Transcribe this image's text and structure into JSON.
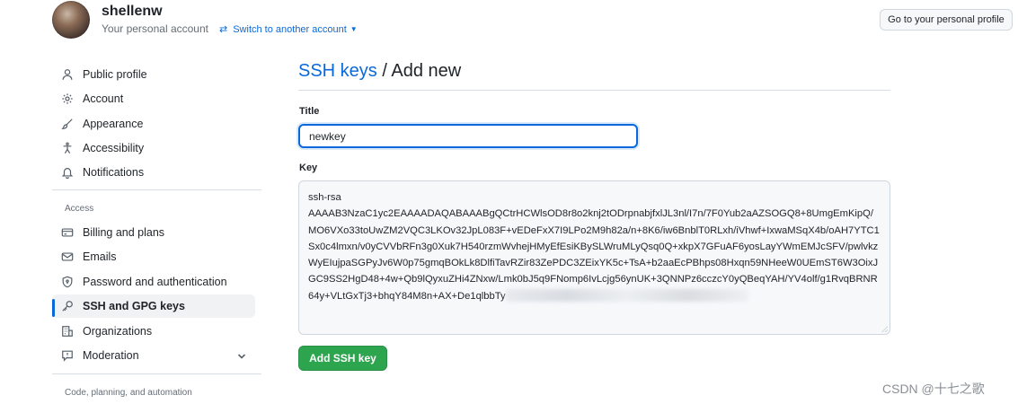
{
  "header": {
    "username": "shellenw",
    "subtitle": "Your personal account",
    "switch_label": "Switch to another account",
    "profile_button": "Go to your personal profile"
  },
  "sidebar": {
    "items": [
      {
        "label": "Public profile",
        "icon": "person-icon"
      },
      {
        "label": "Account",
        "icon": "gear-icon"
      },
      {
        "label": "Appearance",
        "icon": "paintbrush-icon"
      },
      {
        "label": "Accessibility",
        "icon": "accessibility-icon"
      },
      {
        "label": "Notifications",
        "icon": "bell-icon"
      }
    ],
    "access_heading": "Access",
    "access_items": [
      {
        "label": "Billing and plans",
        "icon": "credit-card-icon"
      },
      {
        "label": "Emails",
        "icon": "mail-icon"
      },
      {
        "label": "Password and authentication",
        "icon": "shield-lock-icon"
      },
      {
        "label": "SSH and GPG keys",
        "icon": "key-icon",
        "active": true
      },
      {
        "label": "Organizations",
        "icon": "organization-icon"
      },
      {
        "label": "Moderation",
        "icon": "report-icon"
      }
    ],
    "code_heading": "Code, planning, and automation"
  },
  "main": {
    "breadcrumb": "SSH keys",
    "separator": "/",
    "title": "Add new",
    "title_label": "Title",
    "title_value": "newkey",
    "key_label": "Key",
    "key_value": "ssh-rsa\nAAAAB3NzaC1yc2EAAAADAQABAAABgQCtrHCWlsOD8r8o2knj2tODrpnabjfxlJL3nl/I7n/7F0Yub2aAZSOGQ8+8UmgEmKipQ/MO6VXo33toUwZM2VQC3LKOv32JpL083F+vEDeFxX7I9LPo2M9h82a/n+8K6/iw6BnblT0RLxh/iVhwf+IxwaMSqX4b/oAH7YTC1Sx0c4lmxn/v0yCVVbRFn3g0Xuk7H540rzmWvhejHMyEfEsiKBySLWruMLyQsq0Q+xkpX7GFuAF6yosLayYWmEMJcSFV/pwlvkzWyEIujpaSGPyJv6W0p75gmqBOkLk8DlfiTavRZir83ZePDC3ZEixYK5c+TsA+b2aaEcPBhps08Hxqn59NHeeW0UEmST6W3OixJGC9SS2HgD48+4w+Qb9lQyxuZHi4ZNxw/Lmk0bJ5q9FNomp6IvLcjg56ynUK+3QNNPz6cczcY0yQBeqYAH/YV4olf/g1RvqBRNR64y+VLtGxTj3+bhqY84M8n+AX+De1qlbbTy",
    "submit_label": "Add SSH key"
  },
  "watermark": "CSDN @十七之歌",
  "colors": {
    "accent": "#0969da",
    "primary_button": "#2da44e"
  }
}
